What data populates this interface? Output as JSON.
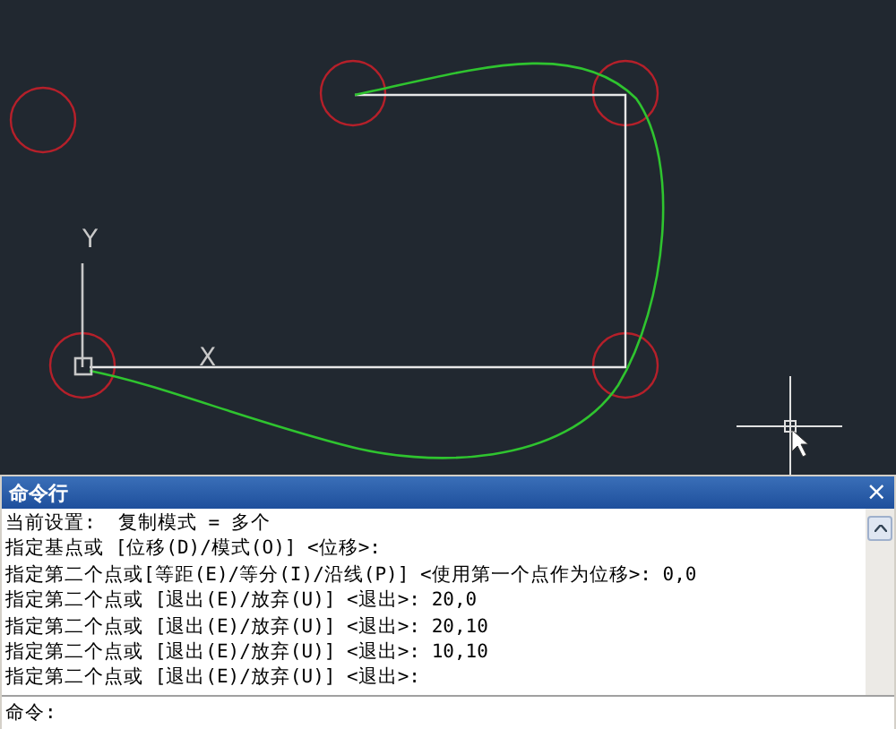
{
  "drawing": {
    "ucs_y_label": "Y",
    "ucs_x_label": "X"
  },
  "command_window": {
    "title": "命令行",
    "close": "×",
    "history": [
      "当前设置:  复制模式 = 多个",
      "指定基点或 [位移(D)/模式(O)] <位移>:",
      "指定第二个点或[等距(E)/等分(I)/沿线(P)] <使用第一个点作为位移>: 0,0",
      "指定第二个点或 [退出(E)/放弃(U)] <退出>: 20,0",
      "指定第二个点或 [退出(E)/放弃(U)] <退出>: 20,10",
      "指定第二个点或 [退出(E)/放弃(U)] <退出>: 10,10",
      "指定第二个点或 [退出(E)/放弃(U)] <退出>:"
    ],
    "prompt": "命令:"
  }
}
